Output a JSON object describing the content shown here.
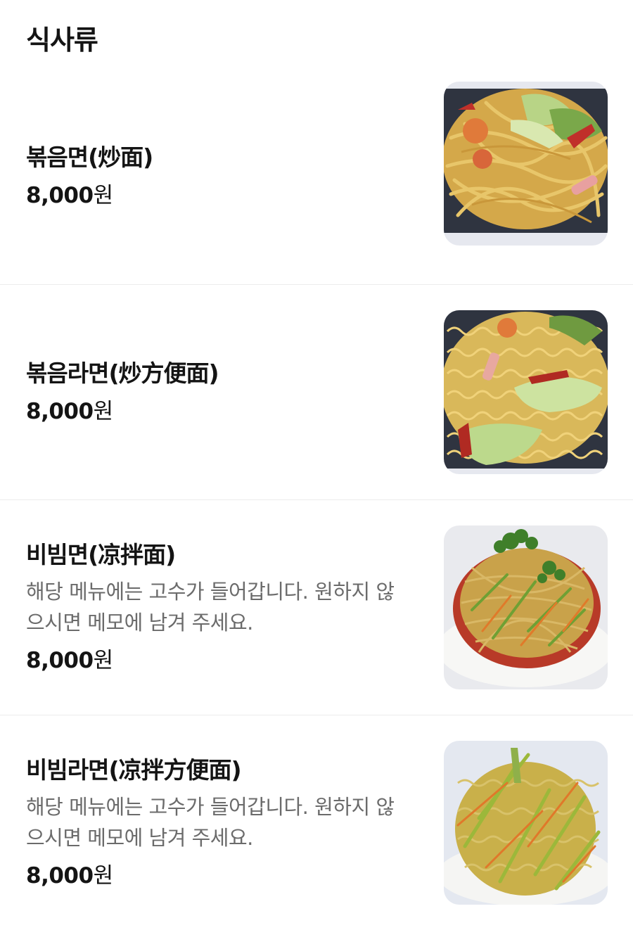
{
  "section": {
    "title": "식사류"
  },
  "items": [
    {
      "name": "볶음면(炒面)",
      "description": "",
      "price": "8,000",
      "currency": "원",
      "photo_icon": "fried-noodles-photo"
    },
    {
      "name": "볶음라면(炒方便面)",
      "description": "",
      "price": "8,000",
      "currency": "원",
      "photo_icon": "fried-ramen-photo"
    },
    {
      "name": "비빔면(凉拌面)",
      "description": "해당 메뉴에는 고수가 들어갑니다. 원하지 않으시면 메모에 남겨 주세요.",
      "price": "8,000",
      "currency": "원",
      "photo_icon": "cold-mixed-noodles-photo"
    },
    {
      "name": "비빔라면(凉拌方便面)",
      "description": "해당 메뉴에는 고수가 들어갑니다. 원하지 않으시면 메모에 남겨 주세요.",
      "price": "8,000",
      "currency": "원",
      "photo_icon": "cold-mixed-ramen-photo"
    }
  ],
  "colors": {
    "text_primary": "#141414",
    "text_secondary": "#6b6b6b",
    "divider": "#ececec"
  }
}
